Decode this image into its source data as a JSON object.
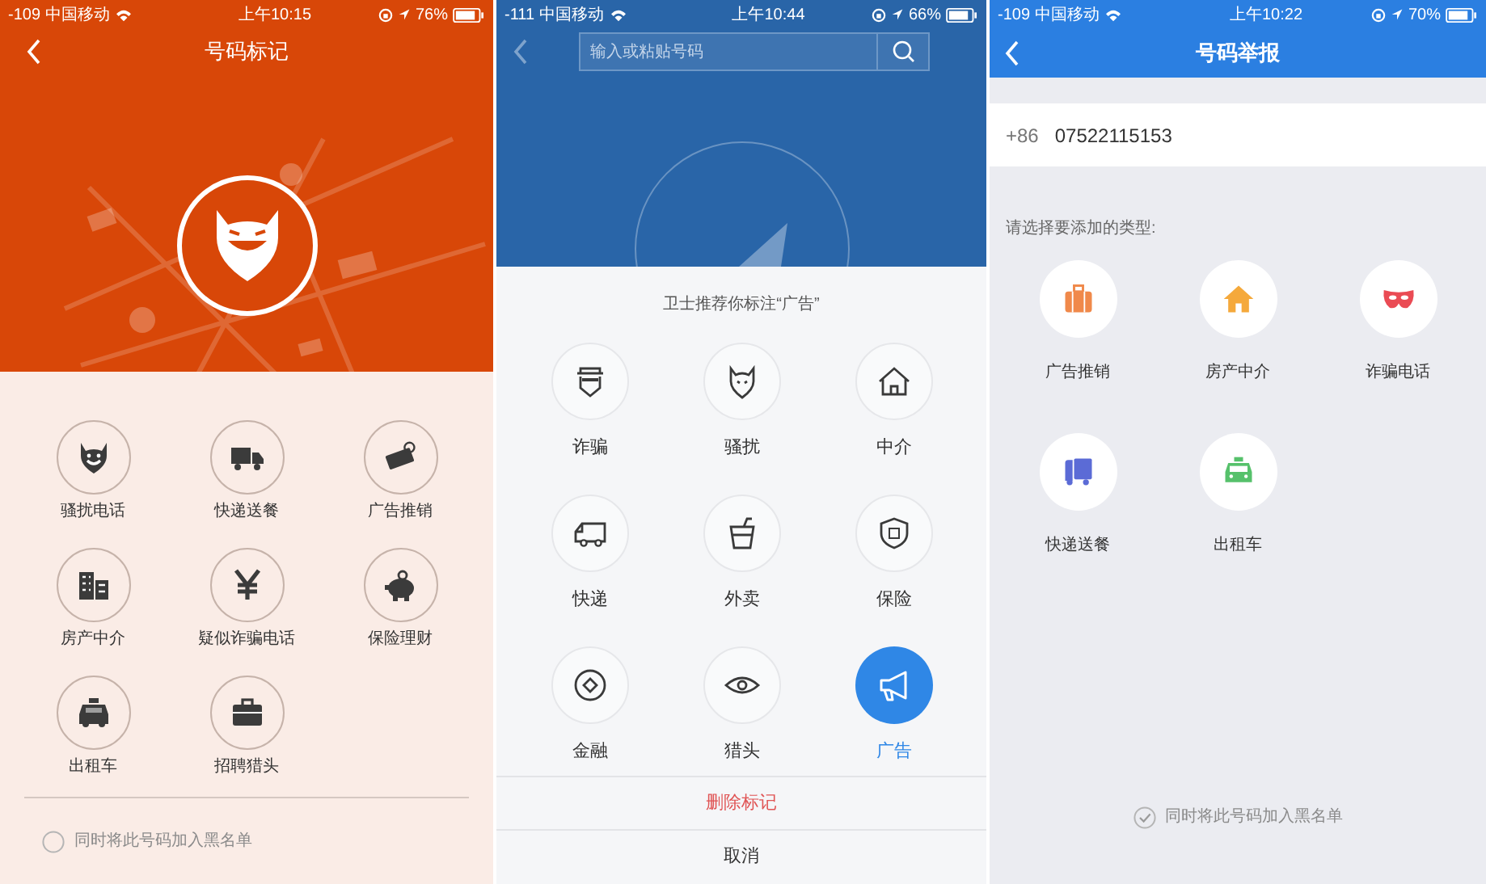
{
  "mark_screen": {
    "status_bar": {
      "signal": "-109",
      "carrier": "中国移动",
      "time": "上午10:15",
      "battery": "76%"
    },
    "title": "号码标记",
    "categories": [
      {
        "label": "骚扰电话"
      },
      {
        "label": "快递送餐"
      },
      {
        "label": "广告推销"
      },
      {
        "label": "房产中介"
      },
      {
        "label": "疑似诈骗电话"
      },
      {
        "label": "保险理财"
      },
      {
        "label": "出租车"
      },
      {
        "label": "招聘猎头"
      }
    ],
    "blacklist": {
      "label": "同时将此号码加入黑名单",
      "checked": false
    }
  },
  "sheet_screen": {
    "status_bar": {
      "signal": "-111",
      "carrier": "中国移动",
      "time": "上午10:44",
      "battery": "66%"
    },
    "search": {
      "placeholder": "输入或粘贴号码"
    },
    "suggestion": "卫士推荐你标注“广告”",
    "categories": [
      {
        "label": "诈骗",
        "selected": false
      },
      {
        "label": "骚扰",
        "selected": false
      },
      {
        "label": "中介",
        "selected": false
      },
      {
        "label": "快递",
        "selected": false
      },
      {
        "label": "外卖",
        "selected": false
      },
      {
        "label": "保险",
        "selected": false
      },
      {
        "label": "金融",
        "selected": false
      },
      {
        "label": "猎头",
        "selected": false
      },
      {
        "label": "广告",
        "selected": true
      }
    ],
    "actions": [
      {
        "label": "删除标记",
        "kind": "destructive"
      },
      {
        "label": "取消",
        "kind": "cancel"
      }
    ]
  },
  "report_screen": {
    "status_bar": {
      "signal": "-109",
      "carrier": "中国移动",
      "time": "上午10:22",
      "battery": "70%"
    },
    "title": "号码举报",
    "phone": {
      "prefix": "+86",
      "number": "07522115153"
    },
    "prompt": "请选择要添加的类型:",
    "categories": [
      {
        "label": "广告推销"
      },
      {
        "label": "房产中介"
      },
      {
        "label": "诈骗电话"
      },
      {
        "label": "快递送餐"
      },
      {
        "label": "出租车"
      }
    ],
    "blacklist": {
      "label": "同时将此号码加入黑名单",
      "checked": true
    }
  }
}
